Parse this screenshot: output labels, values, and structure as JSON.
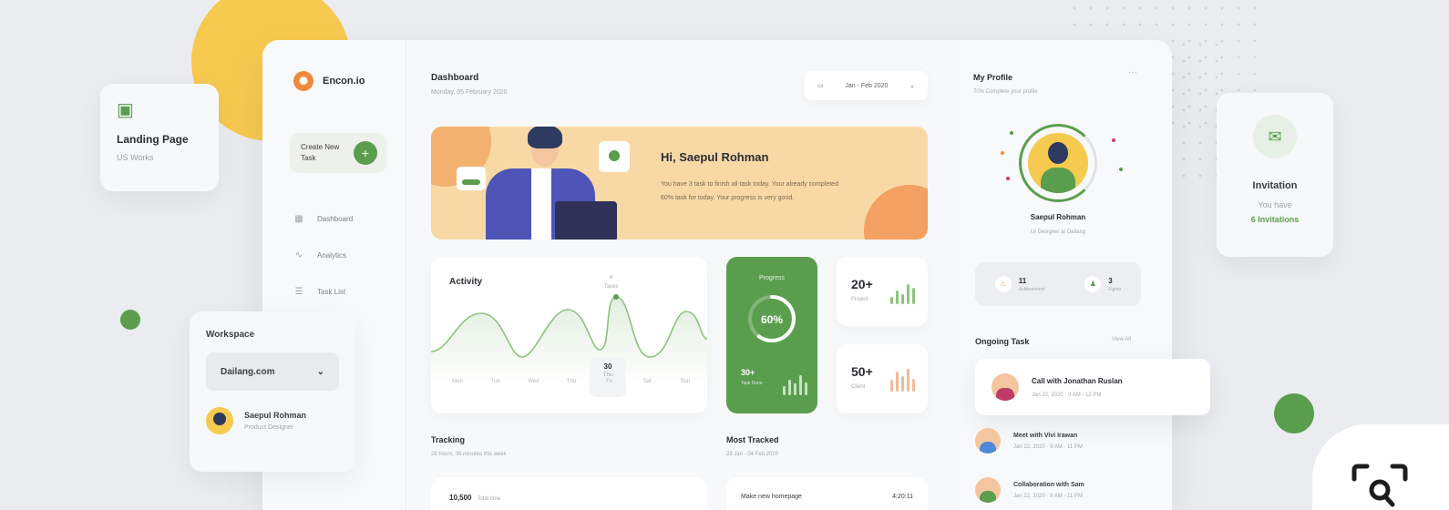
{
  "colors": {
    "accent": "#5a9e4d",
    "yellow": "#f6c94f",
    "banner": "#f8d9a6",
    "orange": "#f08a3c"
  },
  "landing": {
    "icon": "document-icon",
    "title": "Landing Page",
    "subtitle": "US Works"
  },
  "invitation": {
    "icon": "mail-icon",
    "title": "Invitation",
    "subtitle": "You have",
    "count": "6 Invitations"
  },
  "workspace": {
    "title": "Workspace",
    "selected": "Dailang.com",
    "user_name": "Saepul Rohman",
    "user_sub": "Product Designer"
  },
  "sidebar": {
    "logo_text": "Encon.io",
    "create_label": "Create New Task",
    "items": [
      {
        "icon": "grid-icon",
        "label": "Dashboard"
      },
      {
        "icon": "chart-icon",
        "label": "Analytics"
      },
      {
        "icon": "list-icon",
        "label": "Task List"
      }
    ]
  },
  "header": {
    "title": "Dashboard",
    "date": "Monday, 05 February 2020",
    "date_picker": "Jan - Feb 2020"
  },
  "banner": {
    "greeting": "Hi, Saepul Rohman",
    "message": "You have 3 task to finish all task today. Your already completed 60% task for today. Your progress is very good."
  },
  "activity": {
    "title": "Activity",
    "tooltip_value": "4",
    "tooltip_label": "Tasks",
    "selected_value": "30",
    "selected_day": "Thu",
    "days": [
      "Mon",
      "Tue",
      "Wed",
      "Thu",
      "Fri",
      "Sat",
      "Sun"
    ]
  },
  "progress": {
    "title": "Progress",
    "value": "60%",
    "percent": 60,
    "count": "30+",
    "count_label": "Task Done",
    "bar_levels": [
      40,
      70,
      55,
      90,
      60
    ]
  },
  "stats": [
    {
      "value": "20+",
      "label": "Project",
      "bar_levels": [
        30,
        55,
        40,
        80,
        65
      ]
    },
    {
      "value": "50+",
      "label": "Client",
      "bar_levels": [
        45,
        80,
        60,
        90,
        50
      ]
    }
  ],
  "tracking": {
    "title": "Tracking",
    "subtitle": "28 hours, 38 minutes this week",
    "value": "10,500",
    "value_label": "Total time"
  },
  "most_tracked": {
    "title": "Most Tracked",
    "subtitle": "28 Jan - 04 Feb 2020",
    "item": "Make new homepage",
    "time": "4:20:11"
  },
  "profile": {
    "title": "My Profile",
    "subtitle": "70% Complete your profile",
    "more": "···",
    "name": "Saepul Rohman",
    "role": "UI Designer at Dailang",
    "stats": [
      {
        "icon": "fire-icon",
        "value": "11",
        "label": "Achievement"
      },
      {
        "icon": "user-icon",
        "value": "3",
        "label": "Figma"
      }
    ]
  },
  "ongoing": {
    "title": "Ongoing Task",
    "view_all": "View All",
    "tasks": [
      {
        "name": "Call with Jonathan Ruslan",
        "time": "Jan 22, 2020 · 9 AM - 12 PM"
      },
      {
        "name": "Meet with Vivi Irawan",
        "time": "Jan 22, 2020 · 9 AM - 11 PM"
      },
      {
        "name": "Collaboration with Sam",
        "time": "Jan 22, 2020 · 9 AM - 11 PM"
      }
    ]
  },
  "lens": {
    "icon": "visual-search-icon"
  }
}
